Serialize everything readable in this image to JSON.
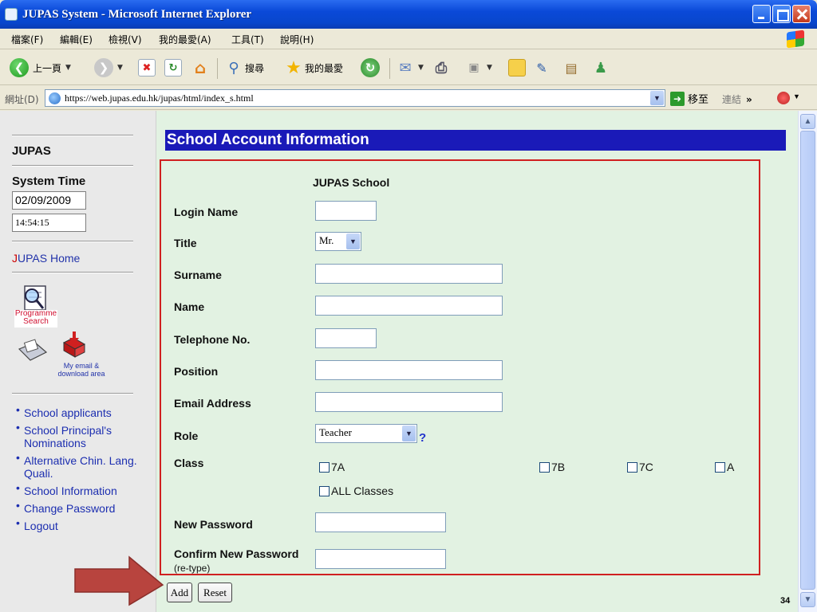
{
  "window": {
    "title": "JUPAS System - Microsoft Internet Explorer"
  },
  "menubar": [
    "檔案(F)",
    "編輯(E)",
    "檢視(V)",
    "我的最愛(A)",
    "工具(T)",
    "說明(H)"
  ],
  "toolbar": {
    "back_label": "上一頁",
    "search_label": "搜尋",
    "favorites_label": "我的最愛"
  },
  "addressbar": {
    "label": "網址(D)",
    "url": "https://web.jupas.edu.hk/jupas/html/index_s.html",
    "go_label": "移至",
    "links_label": "連結"
  },
  "sidebar": {
    "title": "JUPAS",
    "system_time_label": "System Time",
    "date": "02/09/2009",
    "time": "14:54:15",
    "home_link_j": "J",
    "home_link_rest": "UPAS Home",
    "programme_search_label": [
      "Programme",
      "Search"
    ],
    "email_area_label": [
      "My email &",
      "download area"
    ],
    "nav": [
      "School applicants",
      "School Principal's Nominations",
      "Alternative Chin. Lang. Quali.",
      "School Information",
      "Change Password",
      "Logout"
    ]
  },
  "main": {
    "title": "School Account Information",
    "school_header": "JUPAS School",
    "labels": {
      "login_name": "Login Name",
      "title": "Title",
      "surname": "Surname",
      "name": "Name",
      "telephone": "Telephone No.",
      "position": "Position",
      "email": "Email Address",
      "role": "Role",
      "class": "Class",
      "new_password": "New Password",
      "confirm_password": "Confirm New Password",
      "confirm_hint": "(re-type)"
    },
    "title_select_value": "Mr.",
    "role_select_value": "Teacher",
    "help_mark": "?",
    "classes": [
      "7A",
      "7B",
      "7C",
      "A",
      "ALL Classes"
    ],
    "add_label": "Add",
    "reset_label": "Reset"
  },
  "slide_number": "34",
  "colors": {
    "title_bg": "#1a1ab8",
    "form_border": "#d02020",
    "content_bg": "#e2f2e2",
    "link": "#1c2eb0",
    "arrow": "#b8443e"
  }
}
